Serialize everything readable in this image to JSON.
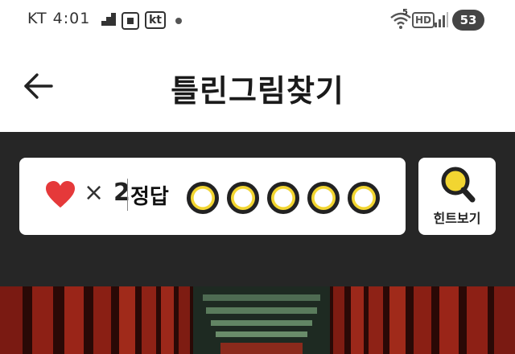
{
  "status_bar": {
    "carrier": "KT 4:01",
    "operator_badge": "kt",
    "battery_level": "53",
    "network_label": "HD",
    "wifi_badge": "5"
  },
  "header": {
    "title": "틀린그림찾기",
    "back_icon": "arrow-left-icon"
  },
  "game": {
    "lives_icon": "heart-icon",
    "times_symbol": "×",
    "lives_count": "2",
    "answer_label": "정답",
    "answers_found": 0,
    "answers_total": 5
  },
  "hint": {
    "label": "힌트보기",
    "icon": "magnifier-icon"
  },
  "colors": {
    "accent_yellow": "#f2d531",
    "panel_dark": "#262626",
    "heart_red": "#e5393a"
  }
}
